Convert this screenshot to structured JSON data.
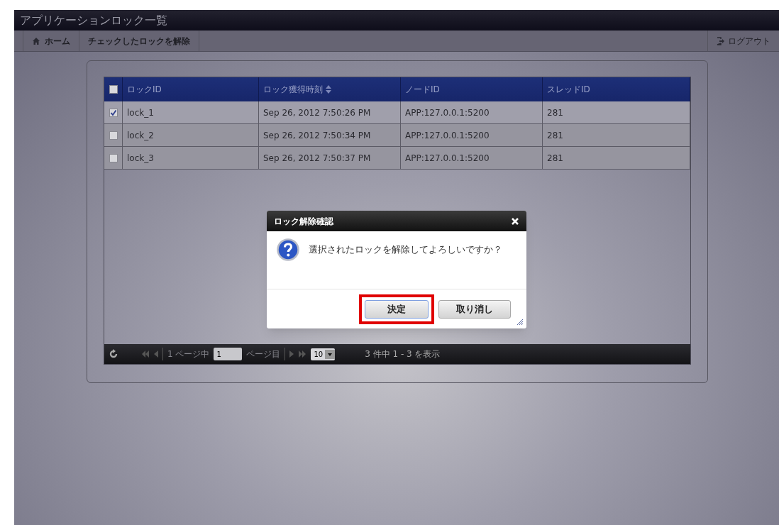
{
  "window": {
    "title": "アプリケーションロック一覧"
  },
  "toolbar": {
    "items": [
      {
        "label": "ホーム",
        "kind": "home"
      },
      {
        "label": "チェックしたロックを解除",
        "kind": "plain"
      }
    ],
    "logout": "ログアウト"
  },
  "table": {
    "header_checked": false,
    "columns": [
      {
        "label": "ロックID",
        "sortable": false
      },
      {
        "label": "ロック獲得時刻",
        "sortable": true
      },
      {
        "label": "ノードID",
        "sortable": false
      },
      {
        "label": "スレッドID",
        "sortable": false
      }
    ],
    "rows": [
      {
        "checked": true,
        "cells": [
          "lock_1",
          "Sep 26, 2012 7:50:26 PM",
          "APP:127.0.0.1:5200",
          "281"
        ]
      },
      {
        "checked": false,
        "cells": [
          "lock_2",
          "Sep 26, 2012 7:50:34 PM",
          "APP:127.0.0.1:5200",
          "281"
        ]
      },
      {
        "checked": false,
        "cells": [
          "lock_3",
          "Sep 26, 2012 7:50:37 PM",
          "APP:127.0.0.1:5200",
          "281"
        ]
      }
    ]
  },
  "pager": {
    "before_page": "1 ページ中",
    "page": "1",
    "after_page": "ページ目",
    "page_size": "10",
    "summary": "3 件中 1 - 3 を表示"
  },
  "dialog": {
    "title": "ロック解除確認",
    "message": "選択されたロックを解除してよろしいですか？",
    "buttons": [
      {
        "label": "決定",
        "highlighted": true
      },
      {
        "label": "取り消し",
        "highlighted": false
      }
    ]
  }
}
